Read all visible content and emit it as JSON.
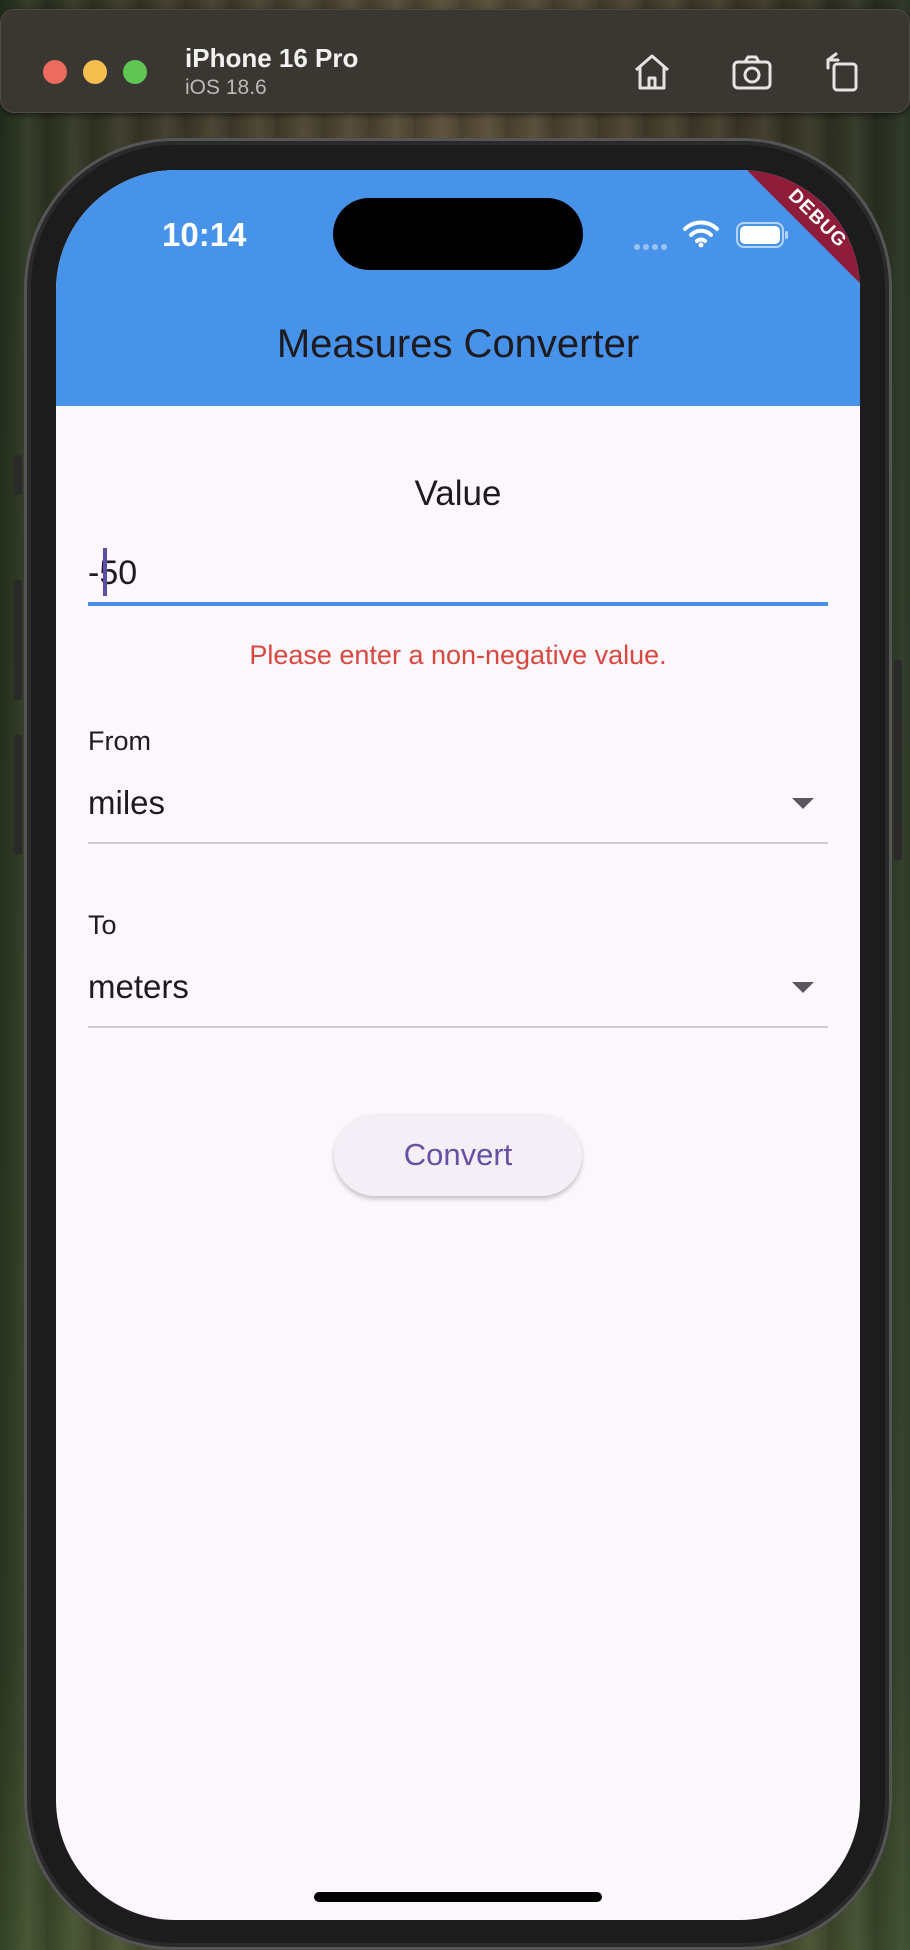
{
  "simulator": {
    "device_name": "iPhone 16 Pro",
    "os_version": "iOS 18.6",
    "toolbar": [
      "home-icon",
      "screenshot-icon",
      "rotate-icon"
    ]
  },
  "status_bar": {
    "time": "10:14",
    "debug_banner": "DEBUG"
  },
  "app_bar": {
    "title": "Measures Converter",
    "color": "#4893ea"
  },
  "form": {
    "value_label": "Value",
    "value_input": "-50",
    "error_message": "Please enter a non-negative value.",
    "error_color": "#d9473f",
    "from_label": "From",
    "from_value": "miles",
    "to_label": "To",
    "to_value": "meters",
    "convert_label": "Convert"
  }
}
